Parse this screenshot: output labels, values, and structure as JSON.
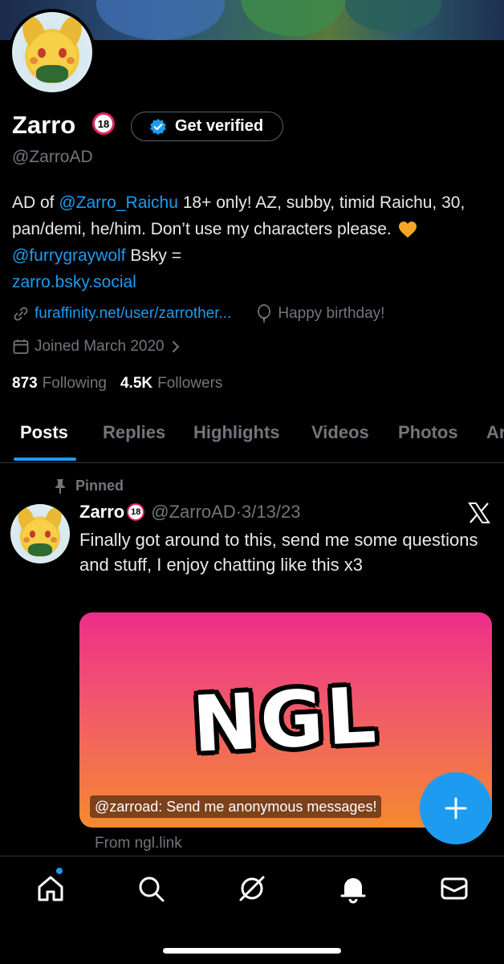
{
  "profile": {
    "name": "Zarro",
    "age_badge": "18",
    "get_verified_label": "Get verified",
    "handle": "@ZarroAD",
    "bio": {
      "part1": "AD of ",
      "mention1": "@Zarro_Raichu",
      "part2": " 18+ only! AZ, subby, timid Raichu, 30, pan/demi, he/him. Don’t use my characters please. ",
      "mention2": "@furrygraywolf",
      "part3": " Bsky = ",
      "link": "zarro.bsky.social"
    },
    "website": "furaffinity.net/user/zarrother...",
    "birthday": "Happy birthday!",
    "joined": "Joined March 2020",
    "following_count": "873",
    "following_label": "Following",
    "followers_count": "4.5K",
    "followers_label": "Followers"
  },
  "tabs": [
    {
      "label": "Posts"
    },
    {
      "label": "Replies"
    },
    {
      "label": "Highlights"
    },
    {
      "label": "Videos"
    },
    {
      "label": "Photos"
    },
    {
      "label": "Ar"
    }
  ],
  "pinned_post": {
    "pinned_label": "Pinned",
    "author_name": "Zarro",
    "age_badge": "18",
    "author_handle": "@ZarroAD",
    "separator": " · ",
    "date": "3/13/23",
    "text": "Finally got around to this, send me some questions and stuff, I enjoy chatting like this x3",
    "card": {
      "title": "NGL",
      "caption": "@zarroad: Send me anonymous messages!",
      "source": "From ngl.link"
    }
  },
  "fab_label": "+",
  "colors": {
    "accent": "#1d9bf0",
    "background": "#000000",
    "muted_text": "#71767b",
    "heart": "#f5a623"
  }
}
